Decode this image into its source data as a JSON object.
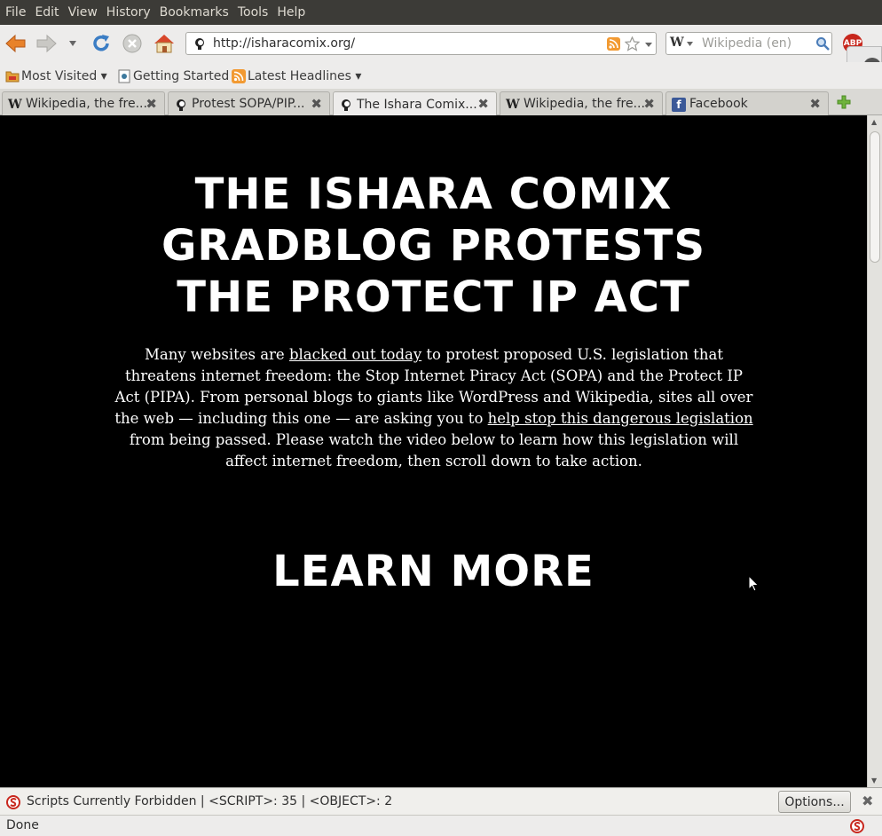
{
  "menubar": {
    "items": [
      {
        "label": "File"
      },
      {
        "label": "Edit"
      },
      {
        "label": "View"
      },
      {
        "label": "History"
      },
      {
        "label": "Bookmarks"
      },
      {
        "label": "Tools"
      },
      {
        "label": "Help"
      }
    ]
  },
  "navbar": {
    "back_icon": "back-arrow-icon",
    "forward_icon": "forward-arrow-icon",
    "history_dropdown_icon": "chevron-down-icon",
    "reload_icon": "reload-icon",
    "stop_icon": "stop-icon",
    "home_icon": "home-icon",
    "url": "http://isharacomix.org/",
    "search_engine_badge": "W",
    "search_placeholder": "Wikipedia (en)",
    "adblock_badge": "ABP"
  },
  "bookmarks": {
    "items": [
      {
        "label": "Most Visited ▾",
        "icon": "folder-icon"
      },
      {
        "label": "Getting Started",
        "icon": "page-icon"
      },
      {
        "label": "Latest Headlines ▾",
        "icon": "rss-icon"
      }
    ]
  },
  "tabs": [
    {
      "label": "Wikipedia, the fre...",
      "icon": "wikipedia-icon",
      "active": false
    },
    {
      "label": "Protest SOPA/PIP...",
      "icon": "ishara-icon",
      "active": false
    },
    {
      "label": "The Ishara Comix...",
      "icon": "ishara-icon",
      "active": true
    },
    {
      "label": "Wikipedia, the fre...",
      "icon": "wikipedia-icon",
      "active": false
    },
    {
      "label": "Facebook",
      "icon": "facebook-icon",
      "active": false
    }
  ],
  "page": {
    "headline_lines": [
      "THE ISHARA COMIX",
      "GRADBLOG PROTESTS",
      "THE PROTECT IP ACT"
    ],
    "body": {
      "t1": "Many websites are ",
      "link1": "blacked out today",
      "t2": " to protest proposed U.S. legislation that threatens internet freedom: the Stop Internet Piracy Act (SOPA) and the Protect IP Act (PIPA). From personal blogs to giants like WordPress and Wikipedia, sites all over the web — including this one — are asking you to ",
      "link2": "help stop this dangerous legislation",
      "t3": " from being passed. Please watch the video below to learn how this legislation will affect internet freedom, then scroll down to take action."
    },
    "learn_more": "LEARN MORE"
  },
  "noscript": {
    "message": "Scripts Currently Forbidden | <SCRIPT>: 35 | <OBJECT>: 2",
    "options_label": "Options...",
    "close_symbol": "✖"
  },
  "status": {
    "text": "Done"
  },
  "colors": {
    "menubar_bg": "#3c3b37",
    "content_bg": "#000000",
    "content_text": "#ffffff"
  }
}
